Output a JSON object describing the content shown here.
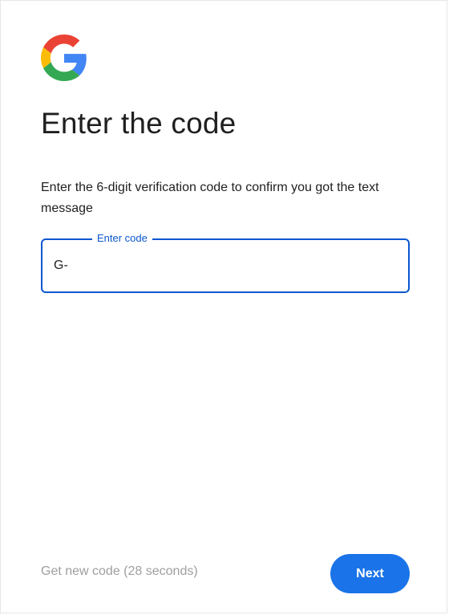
{
  "brand": {
    "logo_icon": "google-g-logo",
    "colors": {
      "blue": "#4285f4",
      "red": "#ea4335",
      "yellow": "#fbbc05",
      "green": "#34a853",
      "accent": "#0b57d0",
      "button": "#1a73e8"
    }
  },
  "page": {
    "title": "Enter the code",
    "subtitle": "Enter the 6-digit verification code to confirm you got the text message"
  },
  "code_field": {
    "label": "Enter code",
    "value": "G-"
  },
  "footer": {
    "get_new_code": "Get new code (28 seconds)",
    "next_label": "Next"
  }
}
